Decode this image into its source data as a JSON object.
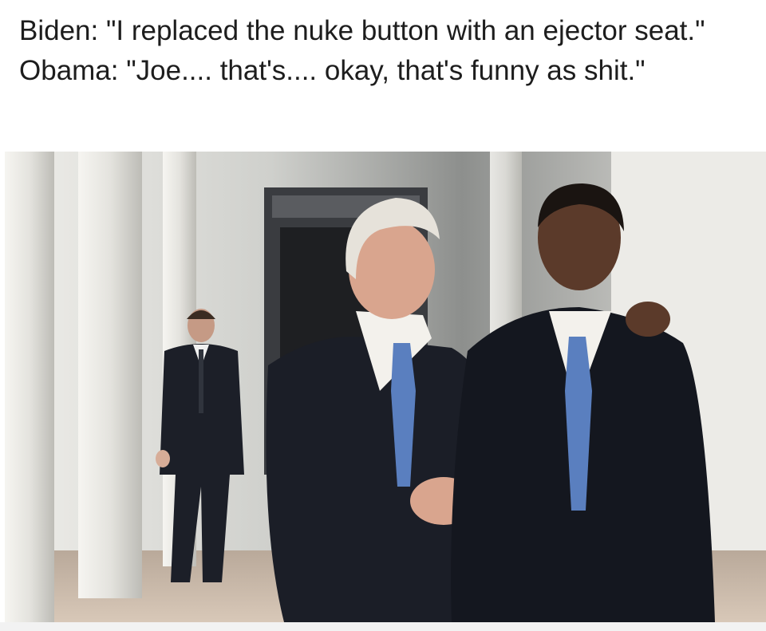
{
  "caption": {
    "line1": "Biden:  \"I replaced the nuke button with an ejector seat.\"",
    "line2": "Obama:  \"Joe.... that's.... okay, that's funny as shit.\""
  },
  "photo": {
    "colors": {
      "colonnade": "#e9e8e3",
      "shadow": "#2b2d31",
      "suit": "#1b1e27",
      "tie": "#5a7fbf",
      "skin": "#d9a58e",
      "skin_dark": "#5b3a2a",
      "hair_white": "#e6e2da"
    }
  }
}
